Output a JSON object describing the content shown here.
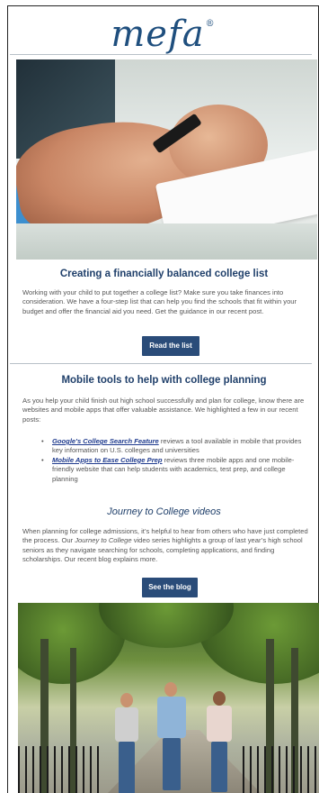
{
  "brand": {
    "logo_text": "mefa",
    "registered": "®"
  },
  "section1": {
    "heading": "Creating a financially balanced college list",
    "body": "Working with your child to put together a college list? Make sure you take finances into consideration. We have a four-step list that can help you find the schools that fit within your budget and offer the financial aid you need. Get the guidance in our recent post.",
    "button": "Read the list"
  },
  "section2": {
    "heading": "Mobile tools to help with college planning",
    "body": "As you help your child finish out high school successfully and plan for college, know there are websites and mobile apps that offer valuable assistance. We highlighted a few in our recent posts:",
    "items": [
      {
        "link": "Google's College Search Feature",
        "text": " reviews a tool available in mobile that provides key information on U.S. colleges and universities"
      },
      {
        "link": "Mobile Apps to Ease College Prep",
        "text": " reviews three mobile apps and one mobile-friendly website that can help students with academics, test prep, and college planning"
      }
    ]
  },
  "section3": {
    "heading": "Journey to College videos",
    "body_pre": "When planning for college admissions, it’s helpful to hear from others who have just completed the process. Our ",
    "body_italic": "Journey to College",
    "body_post": " video series highlights a group of last year’s high school seniors as they navigate searching for schools, completing applications, and finding scholarships. Our recent blog explains more.",
    "button": "See the blog"
  }
}
